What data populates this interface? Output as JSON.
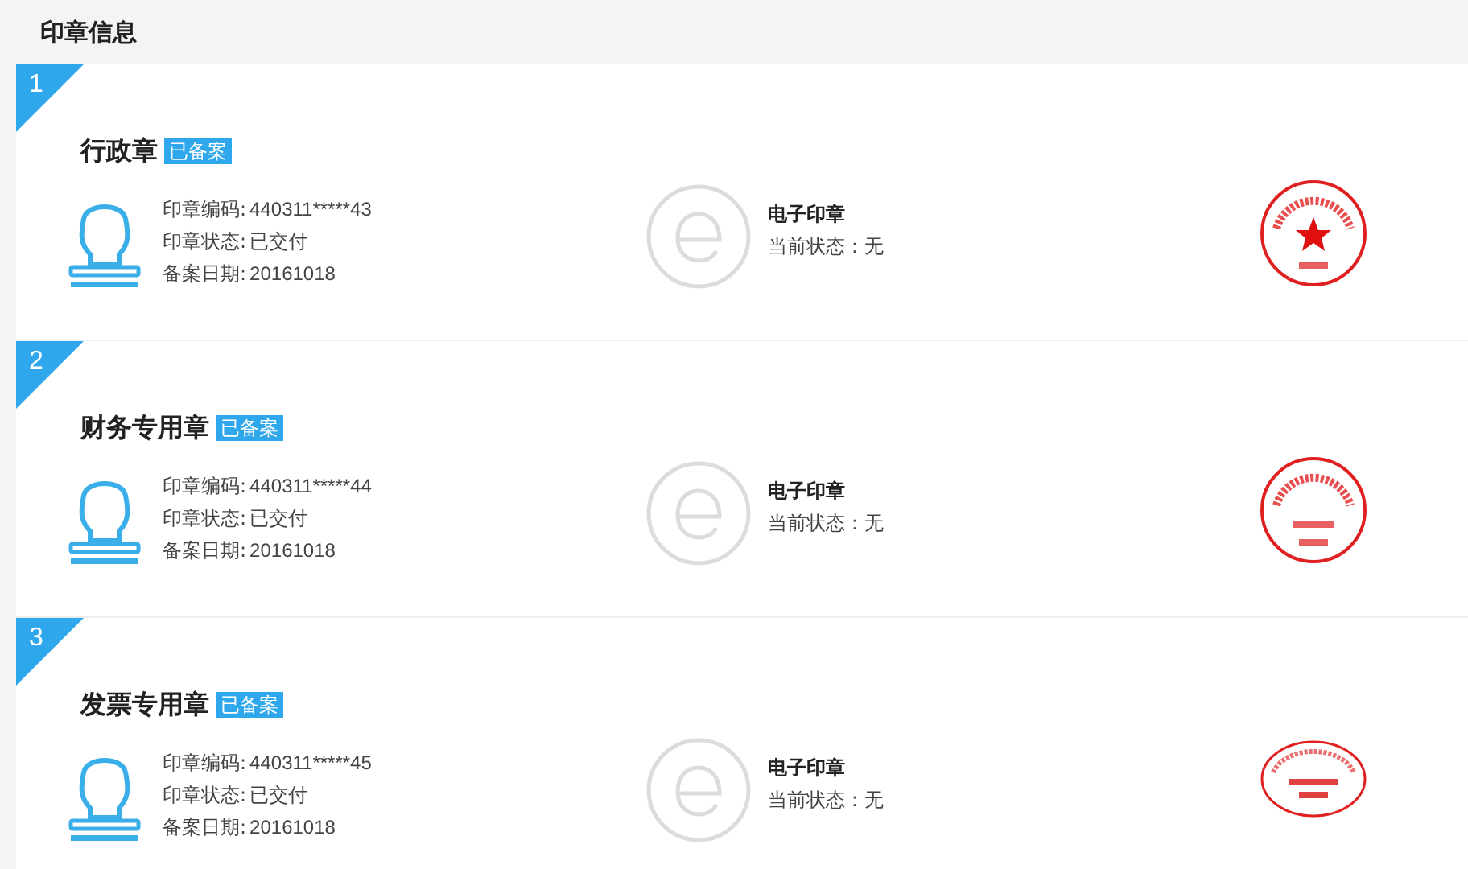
{
  "header": {
    "title": "印章信息"
  },
  "seals": [
    {
      "index": "1",
      "name": "行政章",
      "badge": "已备案",
      "fields": [
        {
          "label": "印章编码:",
          "value": "440311*****43"
        },
        {
          "label": "印章状态:",
          "value": "已交付"
        },
        {
          "label": "备案日期:",
          "value": "20161018"
        }
      ],
      "e_seal": {
        "title": "电子印章",
        "status_label": "当前状态：",
        "status": "无"
      },
      "stamp": {
        "kind": "star"
      }
    },
    {
      "index": "2",
      "name": "财务专用章",
      "badge": "已备案",
      "fields": [
        {
          "label": "印章编码:",
          "value": "440311*****44"
        },
        {
          "label": "印章状态:",
          "value": "已交付"
        },
        {
          "label": "备案日期:",
          "value": "20161018"
        }
      ],
      "e_seal": {
        "title": "电子印章",
        "status_label": "当前状态：",
        "status": "无"
      },
      "stamp": {
        "kind": "round"
      }
    },
    {
      "index": "3",
      "name": "发票专用章",
      "badge": "已备案",
      "fields": [
        {
          "label": "印章编码:",
          "value": "440311*****45"
        },
        {
          "label": "印章状态:",
          "value": "已交付"
        },
        {
          "label": "备案日期:",
          "value": "20161018"
        }
      ],
      "e_seal": {
        "title": "电子印章",
        "status_label": "当前状态：",
        "status": "无"
      },
      "stamp": {
        "kind": "oval"
      }
    }
  ]
}
